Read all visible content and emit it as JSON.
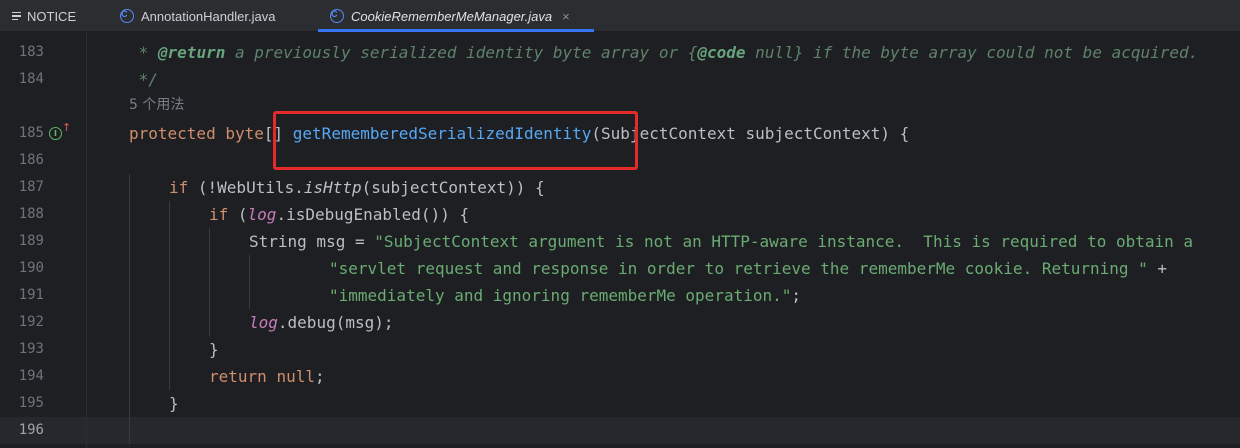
{
  "tabs": [
    {
      "label": "NOTICE",
      "icon": "menu-icon",
      "active": false
    },
    {
      "label": "AnnotationHandler.java",
      "icon": "class-icon",
      "active": false
    },
    {
      "label": "CookieRememberMeManager.java",
      "icon": "class-icon",
      "active": true,
      "close": "×"
    }
  ],
  "editor": {
    "line_numbers": [
      "183",
      "184",
      "185",
      "186",
      "187",
      "188",
      "189",
      "190",
      "191",
      "192",
      "193",
      "194",
      "195",
      "196"
    ],
    "usage_hint": "5 个用法",
    "current_line": "196",
    "gutter_mark": "I",
    "gutter_arrow": "↑"
  },
  "code": {
    "l183_star": " * ",
    "l183_tag": "@return",
    "l183_text1": " a previously serialized identity byte array or {",
    "l183_code": "@code",
    "l183_text2": " null} if the byte array could not be acquired.",
    "l184": " */",
    "l185_kw1": "protected",
    "l185_kw2": "byte",
    "l185_brackets": "[]",
    "l185_fn": "getRememberedSerializedIdentity",
    "l185_rest": "(SubjectContext subjectContext) {",
    "l187_kw": "if",
    "l187_a": " (!WebUtils.",
    "l187_fn": "isHttp",
    "l187_b": "(subjectContext)) {",
    "l188_kw": "if",
    "l188_a": " (",
    "l188_field": "log",
    "l188_b": ".isDebugEnabled()) {",
    "l189_a": "String msg = ",
    "l189_str": "\"SubjectContext argument is not an HTTP-aware instance.  This is required to obtain a",
    "l190_str": "\"servlet request and response in order to retrieve the rememberMe cookie. Returning \"",
    "l190_op": " +",
    "l191_str": "\"immediately and ignoring rememberMe operation.\"",
    "l191_end": ";",
    "l192_field": "log",
    "l192_rest": ".debug(msg);",
    "l193": "}",
    "l194_kw": "return",
    "l194_kw2": "null",
    "l194_end": ";",
    "l195": "}"
  },
  "colors": {
    "highlight_box": "#e52a2a",
    "tab_underline": "#3574f0"
  }
}
